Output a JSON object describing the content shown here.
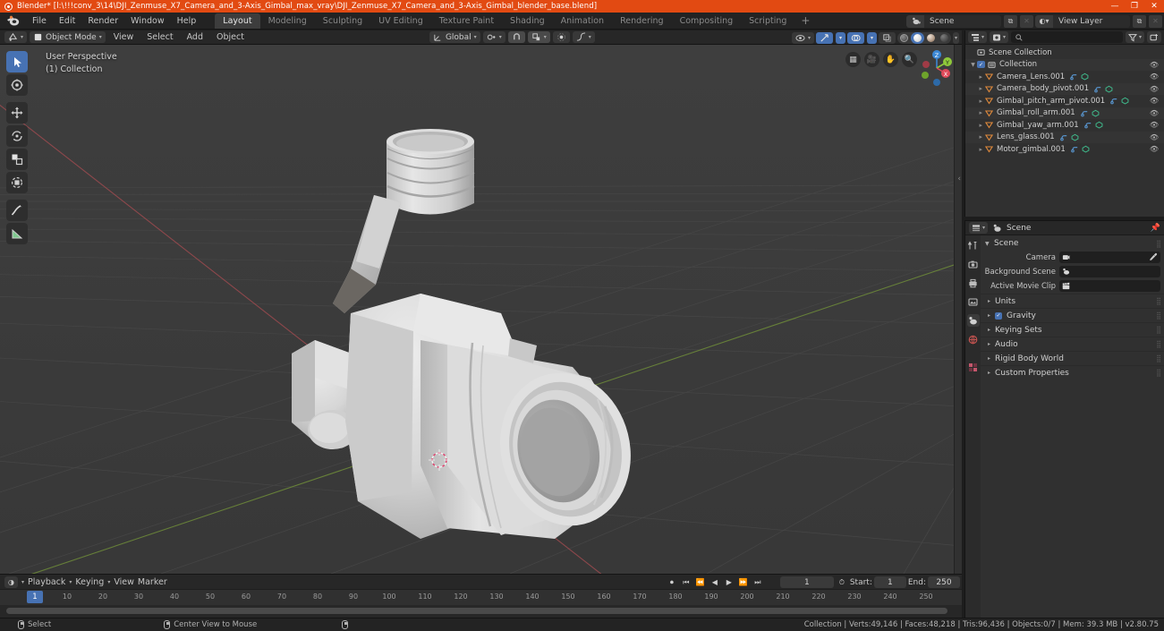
{
  "window": {
    "title": "Blender* [l:\\!!!conv_3\\14\\DJI_Zenmuse_X7_Camera_and_3-Axis_Gimbal_max_vray\\DJI_Zenmuse_X7_Camera_and_3-Axis_Gimbal_blender_base.blend]",
    "minimize": "—",
    "maximize": "❐",
    "close": "✕",
    "accent": "#e24a12"
  },
  "topbar": {
    "menus": [
      "File",
      "Edit",
      "Render",
      "Window",
      "Help"
    ],
    "workspaces": [
      {
        "label": "Layout",
        "active": true
      },
      {
        "label": "Modeling",
        "active": false
      },
      {
        "label": "Sculpting",
        "active": false
      },
      {
        "label": "UV Editing",
        "active": false
      },
      {
        "label": "Texture Paint",
        "active": false
      },
      {
        "label": "Shading",
        "active": false
      },
      {
        "label": "Animation",
        "active": false
      },
      {
        "label": "Rendering",
        "active": false
      },
      {
        "label": "Compositing",
        "active": false
      },
      {
        "label": "Scripting",
        "active": false
      }
    ],
    "add_workspace": "+",
    "scene_name": "Scene",
    "view_layer_name": "View Layer",
    "new_scene_icon": "new-scene-icon",
    "remove_scene_icon": "remove-scene-icon",
    "new_viewlayer_icon": "new-viewlayer-icon",
    "remove_viewlayer_icon": "remove-viewlayer-icon"
  },
  "viewport_header": {
    "editor_type_icon": "editor-type-icon",
    "mode": "Object Mode",
    "menus": [
      "View",
      "Select",
      "Add",
      "Object"
    ],
    "transform_orientation": "Global",
    "pivot_icon": "pivot-point-icon",
    "snap_icon": "snap-magnet-icon",
    "snap_target_icon": "snap-target-icon",
    "proportional_icon": "proportional-edit-icon",
    "falloff_icon": "falloff-curve-icon",
    "visibility_icon": "object-visibility-icon",
    "gizmo_icon": "gizmo-icon",
    "overlays_icon": "overlays-icon",
    "xray_icon": "xray-toggle-icon",
    "shading_modes": [
      "wireframe",
      "solid",
      "material-preview",
      "rendered"
    ],
    "active_shading": "solid"
  },
  "viewport": {
    "perspective_label": "User Perspective",
    "collection_label": "(1) Collection",
    "background": "#3b3b3b",
    "grid_color": "#484848",
    "axis_x_color": "#9c4a4f",
    "axis_y_color": "#6f8c3a",
    "tools": [
      {
        "name": "tweak-select-tool",
        "active": true
      },
      {
        "name": "cursor-tool",
        "active": false
      },
      {
        "name": "move-tool",
        "active": false
      },
      {
        "name": "rotate-tool",
        "active": false
      },
      {
        "name": "scale-tool",
        "active": false
      },
      {
        "name": "transform-tool",
        "active": false
      },
      {
        "name": "annotate-tool",
        "active": false
      },
      {
        "name": "measure-tool",
        "active": false
      }
    ],
    "nav_icons": [
      "zoom-region-icon",
      "camera-view-icon",
      "pan-view-icon",
      "zoom-view-icon"
    ],
    "gizmo_axes": [
      "Z",
      "Y",
      "X"
    ],
    "gizmo_colors": {
      "x": "#e04a5a",
      "y": "#8fc93a",
      "z": "#3b87d4"
    }
  },
  "outliner": {
    "display_mode_icon": "outliner-display-mode-icon",
    "filter_id_icon": "filter-id-icon",
    "search_placeholder": "",
    "search_icon": "search-icon",
    "filter_icon": "funnel-filter-icon",
    "new_collection_icon": "new-collection-icon",
    "root": "Scene Collection",
    "collection": "Collection",
    "objects": [
      {
        "label": "Camera_Lens.001",
        "type": "mesh"
      },
      {
        "label": "Camera_body_pivot.001",
        "type": "mesh"
      },
      {
        "label": "Gimbal_pitch_arm_pivot.001",
        "type": "mesh"
      },
      {
        "label": "Gimbal_roll_arm.001",
        "type": "mesh"
      },
      {
        "label": "Gimbal_yaw_arm.001",
        "type": "mesh"
      },
      {
        "label": "Lens_glass.001",
        "type": "mesh"
      },
      {
        "label": "Motor_gimbal.001",
        "type": "mesh"
      }
    ],
    "eye_icon": "eye-visibility-icon",
    "mesh_data_icon": "mesh-data-icon",
    "modifier_icon": "modifier-icon"
  },
  "properties": {
    "editor_icon": "properties-editor-icon",
    "breadcrumb": "Scene",
    "pin_icon": "pin-icon",
    "tabs": [
      {
        "name": "tool-tab",
        "icon": "⚒",
        "active": false
      },
      {
        "name": "render-tab",
        "icon": "📷",
        "active": false
      },
      {
        "name": "output-tab",
        "icon": "🖨",
        "active": false
      },
      {
        "name": "view-layer-tab",
        "icon": "🖼",
        "active": false
      },
      {
        "name": "scene-tab",
        "icon": "◎",
        "active": true
      },
      {
        "name": "world-tab",
        "icon": "⬤",
        "active": false
      },
      {
        "name": "texture-tab",
        "icon": "▦",
        "active": false
      }
    ],
    "section_title": "Scene",
    "fields": [
      {
        "label": "Camera",
        "value": "",
        "icon": "camera-icon",
        "eyedropper": true
      },
      {
        "label": "Background Scene",
        "value": "",
        "icon": "scene-icon",
        "eyedropper": false
      },
      {
        "label": "Active Movie Clip",
        "value": "",
        "icon": "clapperboard-icon",
        "eyedropper": false
      }
    ],
    "collapsed_sections": [
      {
        "label": "Units",
        "checkbox": false
      },
      {
        "label": "Gravity",
        "checkbox": true
      },
      {
        "label": "Keying Sets",
        "checkbox": false
      },
      {
        "label": "Audio",
        "checkbox": false
      },
      {
        "label": "Rigid Body World",
        "checkbox": false
      },
      {
        "label": "Custom Properties",
        "checkbox": false
      }
    ]
  },
  "timeline": {
    "editor_icon": "timeline-editor-icon",
    "menus": [
      "Playback",
      "Keying",
      "View",
      "Marker"
    ],
    "record_icon": "record-keyframe-icon",
    "transport": [
      "jump-start-icon",
      "prev-keyframe-icon",
      "play-reverse-icon",
      "play-icon",
      "next-keyframe-icon",
      "jump-end-icon"
    ],
    "current_frame": "1",
    "autokey_icon": "auto-keying-icon",
    "start_label": "Start:",
    "start_value": "1",
    "end_label": "End:",
    "end_value": "250",
    "playhead_frame": "1",
    "ruler_ticks": [
      "10",
      "20",
      "30",
      "40",
      "50",
      "60",
      "70",
      "80",
      "90",
      "100",
      "110",
      "120",
      "130",
      "140",
      "150",
      "160",
      "170",
      "180",
      "190",
      "200",
      "210",
      "220",
      "230",
      "240",
      "250"
    ]
  },
  "statusbar": {
    "left_hint": "Select",
    "middle_hint": "Center View to Mouse",
    "stats": "Collection | Verts:49,146 | Faces:48,218 | Tris:96,436 | Objects:0/7 | Mem: 39.3 MB | v2.80.75"
  }
}
